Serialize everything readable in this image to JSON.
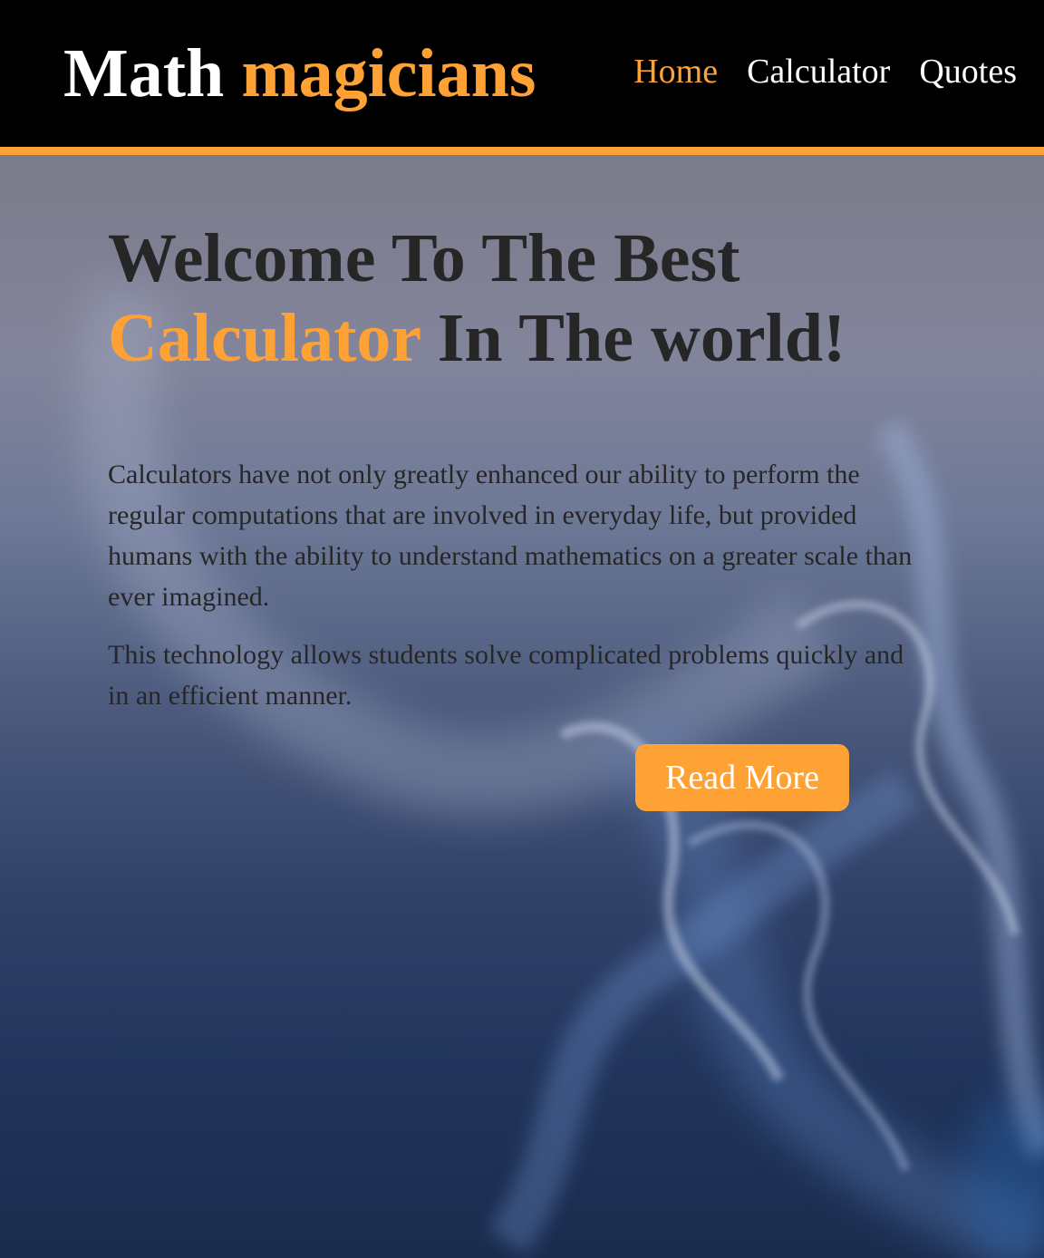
{
  "header": {
    "logo_word1": "Math",
    "logo_word2": "magicians",
    "nav": [
      {
        "label": "Home"
      },
      {
        "label": "Calculator"
      },
      {
        "label": "Quotes"
      }
    ]
  },
  "hero": {
    "title_part1": "Welcome To The Best",
    "title_accent": "Calculator",
    "title_part2": "In The world!",
    "paragraph1": "Calculators have not only greatly enhanced our ability to perform the regular computations that are involved in everyday life, but provided humans with the ability to understand mathematics on a greater scale than ever imagined.",
    "paragraph2": "This technology allows students solve complicated problems quickly and in an efficient manner.",
    "button_label": "Read More"
  },
  "colors": {
    "accent": "#fea236",
    "header_bg": "#000000",
    "text_dark": "#262626"
  }
}
